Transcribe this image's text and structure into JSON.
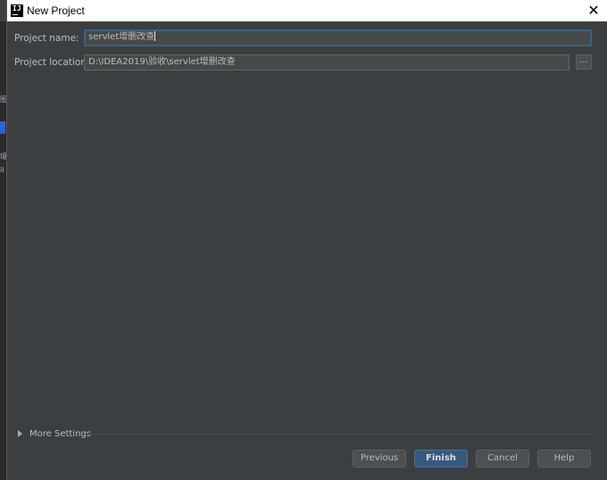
{
  "window": {
    "title": "New Project",
    "close_glyph": "✕",
    "logo_text": "IJ"
  },
  "background": {
    "fragments": [
      "图",
      "境",
      "il"
    ]
  },
  "form": {
    "project_name": {
      "label": "Project name:",
      "value": "servlet增删改查"
    },
    "project_location": {
      "label": "Project location:",
      "value": "D:\\IDEA2019\\验收\\servlet增删改查",
      "browse_label": "..."
    }
  },
  "more_settings": {
    "label": "More Settings"
  },
  "buttons": {
    "previous": "Previous",
    "finish": "Finish",
    "cancel": "Cancel",
    "help": "Help"
  },
  "colors": {
    "background": "#3c3f41",
    "primary_button": "#365880",
    "focus_border": "#3d6185"
  },
  "icons": {
    "logo": "intellij-logo-icon",
    "close": "close-icon",
    "expand": "triangle-right-icon"
  }
}
